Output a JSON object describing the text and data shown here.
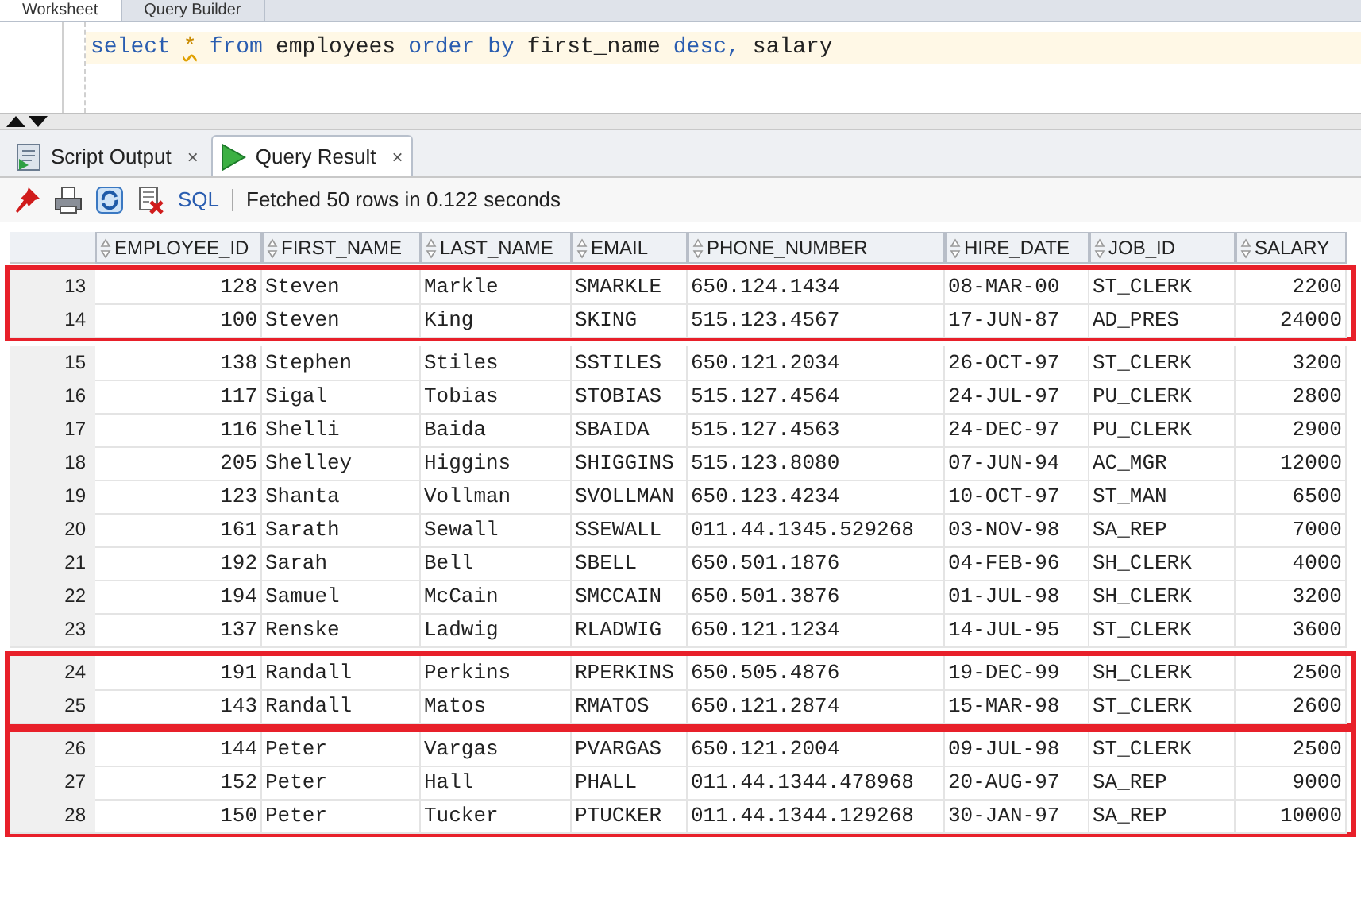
{
  "editor_tabs": [
    {
      "label": "Worksheet",
      "selected": true
    },
    {
      "label": "Query Builder",
      "selected": false
    }
  ],
  "editor": {
    "tokens": [
      {
        "text": "select",
        "kind": "keyword"
      },
      {
        "text": "*",
        "kind": "warning"
      },
      {
        "text": "from",
        "kind": "keyword"
      },
      {
        "text": "employees",
        "kind": "plain"
      },
      {
        "text": "order",
        "kind": "keyword"
      },
      {
        "text": "by",
        "kind": "keyword"
      },
      {
        "text": "first_name",
        "kind": "plain"
      },
      {
        "text": "desc,",
        "kind": "keyword"
      },
      {
        "text": "salary",
        "kind": "plain"
      }
    ]
  },
  "result_tabs": [
    {
      "label": "Script Output",
      "selected": false,
      "close": "×"
    },
    {
      "label": "Query Result",
      "selected": true,
      "close": "×"
    }
  ],
  "toolbar": {
    "sql_link": "SQL",
    "status": "Fetched 50 rows in 0.122 seconds"
  },
  "table": {
    "columns": [
      "EMPLOYEE_ID",
      "FIRST_NAME",
      "LAST_NAME",
      "EMAIL",
      "PHONE_NUMBER",
      "HIRE_DATE",
      "JOB_ID",
      "SALARY"
    ],
    "row_groups": [
      {
        "highlighted": true,
        "rows": [
          {
            "number": "13",
            "cells": [
              "128",
              "Steven",
              "Markle",
              "SMARKLE",
              "650.124.1434",
              "08-MAR-00",
              "ST_CLERK",
              "2200"
            ]
          },
          {
            "number": "14",
            "cells": [
              "100",
              "Steven",
              "King",
              "SKING",
              "515.123.4567",
              "17-JUN-87",
              "AD_PRES",
              "24000"
            ]
          }
        ]
      },
      {
        "highlighted": false,
        "rows": [
          {
            "number": "15",
            "cells": [
              "138",
              "Stephen",
              "Stiles",
              "SSTILES",
              "650.121.2034",
              "26-OCT-97",
              "ST_CLERK",
              "3200"
            ]
          },
          {
            "number": "16",
            "cells": [
              "117",
              "Sigal",
              "Tobias",
              "STOBIAS",
              "515.127.4564",
              "24-JUL-97",
              "PU_CLERK",
              "2800"
            ]
          },
          {
            "number": "17",
            "cells": [
              "116",
              "Shelli",
              "Baida",
              "SBAIDA",
              "515.127.4563",
              "24-DEC-97",
              "PU_CLERK",
              "2900"
            ]
          },
          {
            "number": "18",
            "cells": [
              "205",
              "Shelley",
              "Higgins",
              "SHIGGINS",
              "515.123.8080",
              "07-JUN-94",
              "AC_MGR",
              "12000"
            ]
          },
          {
            "number": "19",
            "cells": [
              "123",
              "Shanta",
              "Vollman",
              "SVOLLMAN",
              "650.123.4234",
              "10-OCT-97",
              "ST_MAN",
              "6500"
            ]
          },
          {
            "number": "20",
            "cells": [
              "161",
              "Sarath",
              "Sewall",
              "SSEWALL",
              "011.44.1345.529268",
              "03-NOV-98",
              "SA_REP",
              "7000"
            ]
          },
          {
            "number": "21",
            "cells": [
              "192",
              "Sarah",
              "Bell",
              "SBELL",
              "650.501.1876",
              "04-FEB-96",
              "SH_CLERK",
              "4000"
            ]
          },
          {
            "number": "22",
            "cells": [
              "194",
              "Samuel",
              "McCain",
              "SMCCAIN",
              "650.501.3876",
              "01-JUL-98",
              "SH_CLERK",
              "3200"
            ]
          },
          {
            "number": "23",
            "cells": [
              "137",
              "Renske",
              "Ladwig",
              "RLADWIG",
              "650.121.1234",
              "14-JUL-95",
              "ST_CLERK",
              "3600"
            ]
          }
        ]
      },
      {
        "highlighted": true,
        "rows": [
          {
            "number": "24",
            "cells": [
              "191",
              "Randall",
              "Perkins",
              "RPERKINS",
              "650.505.4876",
              "19-DEC-99",
              "SH_CLERK",
              "2500"
            ]
          },
          {
            "number": "25",
            "cells": [
              "143",
              "Randall",
              "Matos",
              "RMATOS",
              "650.121.2874",
              "15-MAR-98",
              "ST_CLERK",
              "2600"
            ]
          }
        ]
      },
      {
        "highlighted": true,
        "rows": [
          {
            "number": "26",
            "cells": [
              "144",
              "Peter",
              "Vargas",
              "PVARGAS",
              "650.121.2004",
              "09-JUL-98",
              "ST_CLERK",
              "2500"
            ]
          },
          {
            "number": "27",
            "cells": [
              "152",
              "Peter",
              "Hall",
              "PHALL",
              "011.44.1344.478968",
              "20-AUG-97",
              "SA_REP",
              "9000"
            ]
          },
          {
            "number": "28",
            "cells": [
              "150",
              "Peter",
              "Tucker",
              "PTUCKER",
              "011.44.1344.129268",
              "30-JAN-97",
              "SA_REP",
              "10000"
            ]
          }
        ]
      }
    ]
  }
}
